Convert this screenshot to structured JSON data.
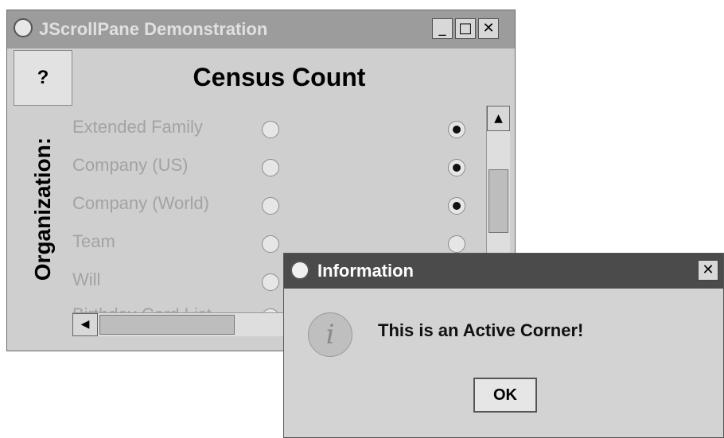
{
  "main_window": {
    "title": "JScrollPane Demonstration",
    "buttons": {
      "minimize": "_",
      "maximize": "□",
      "close": "✕"
    },
    "corner_button": "?",
    "column_header": "Census Count",
    "row_header": "Organization:",
    "rows": [
      {
        "label": "Extended Family",
        "left_selected": false,
        "right_selected": true
      },
      {
        "label": "Company (US)",
        "left_selected": false,
        "right_selected": true
      },
      {
        "label": "Company (World)",
        "left_selected": false,
        "right_selected": true
      },
      {
        "label": "Team",
        "left_selected": false,
        "right_selected": false
      },
      {
        "label": "Will",
        "left_selected": false,
        "right_selected": false
      },
      {
        "label": "Birthday Card List",
        "left_selected": false,
        "right_selected": false
      }
    ],
    "scroll_glyphs": {
      "up": "▲",
      "down": "▼",
      "left": "◀"
    }
  },
  "dialog": {
    "title": "Information",
    "close": "✕",
    "icon_glyph": "i",
    "message": "This is an Active Corner!",
    "ok_label": "OK"
  }
}
